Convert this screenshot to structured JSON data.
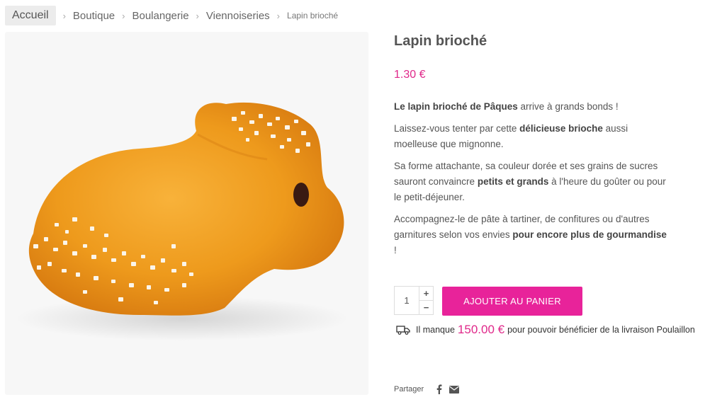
{
  "breadcrumb": {
    "items": [
      "Accueil",
      "Boutique",
      "Boulangerie",
      "Viennoiseries"
    ],
    "current": "Lapin brioché",
    "separator": "›"
  },
  "product": {
    "title": "Lapin brioché",
    "price": "1.30 €",
    "image_icon": "brioche-bunny-photo"
  },
  "description": {
    "p1_bold": "Le lapin brioché de Pâques",
    "p1_text": " arrive à grands bonds !",
    "p2_text1": "Laissez-vous tenter par cette ",
    "p2_bold": "délicieuse brioche",
    "p2_text2": " aussi moelleuse que mignonne.",
    "p3_text1": "Sa forme attachante, sa couleur dorée et ses grains de sucres sauront convaincre ",
    "p3_bold": "petits et grands",
    "p3_text2": " à l'heure du goûter ou pour le petit-déjeuner.",
    "p4_text1": "Accompagnez-le de pâte à tartiner, de confitures ou d'autres garnitures selon vos envies ",
    "p4_bold": "pour encore plus de gourmandise",
    "p4_text2": " !"
  },
  "cart": {
    "quantity": "1",
    "plus": "+",
    "minus": "−",
    "add_label": "AJOUTER AU PANIER"
  },
  "shipping": {
    "prefix": "Il manque",
    "amount": "150.00 €",
    "suffix": "pour pouvoir bénéficier de la livraison Poulaillon",
    "icon": "truck-icon"
  },
  "share": {
    "label": "Partager",
    "icons": [
      "facebook-icon",
      "envelope-icon"
    ]
  },
  "colors": {
    "accent": "#e8239a",
    "price": "#e0288a",
    "text": "#555555"
  }
}
